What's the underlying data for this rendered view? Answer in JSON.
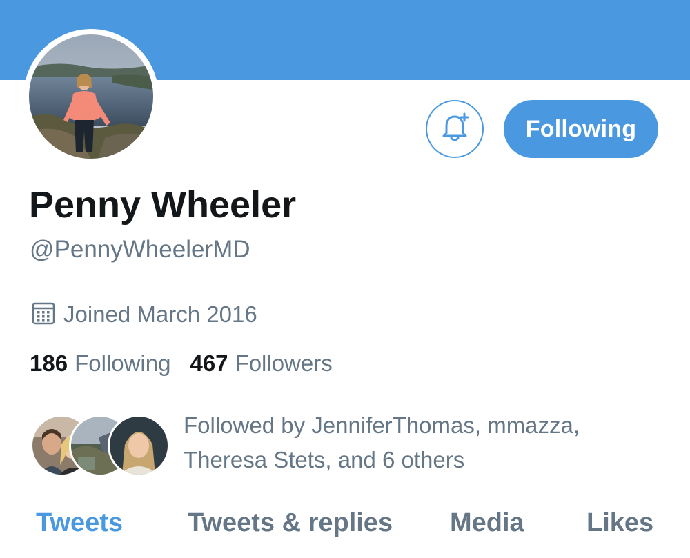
{
  "colors": {
    "accent": "#4a99e0",
    "banner": "#4a99e0",
    "text_primary": "#14171a",
    "text_secondary": "#657786"
  },
  "profile": {
    "display_name": "Penny Wheeler",
    "handle": "@PennyWheelerMD",
    "joined": "Joined March 2016",
    "joined_icon": "calendar-icon",
    "following_count": "186",
    "following_label": "Following",
    "followers_count": "467",
    "followers_label": "Followers"
  },
  "actions": {
    "notifications_icon": "bell-plus-icon",
    "follow_state_label": "Following"
  },
  "followed_by": {
    "line1": "Followed by JenniferThomas, mmazza,",
    "line2": "Theresa Stets, and 6 others",
    "avatar_count": 3
  },
  "tabs": [
    {
      "label": "Tweets",
      "active": true
    },
    {
      "label": "Tweets & replies",
      "active": false
    },
    {
      "label": "Media",
      "active": false
    },
    {
      "label": "Likes",
      "active": false
    }
  ]
}
